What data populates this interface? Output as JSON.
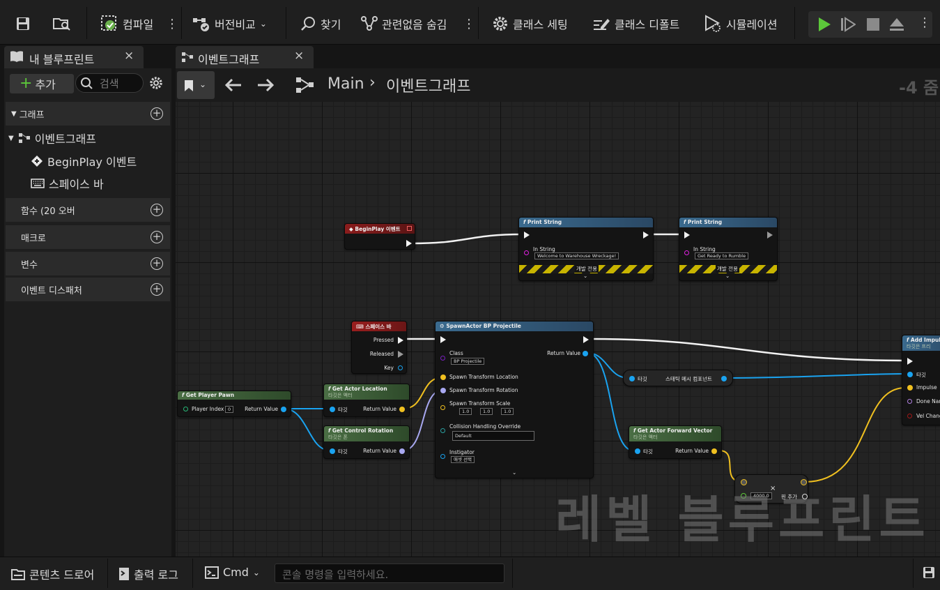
{
  "toolbar": {
    "compile": "컴파일",
    "diff": "버전비교",
    "find": "찾기",
    "hide_unrelated": "관련없음 숨김",
    "class_settings": "클래스 세팅",
    "class_defaults": "클래스 디폴트",
    "simulation": "시뮬레이션"
  },
  "left_panel": {
    "tab_title": "내 블루프린트",
    "add_label": "추가",
    "search_placeholder": "검색",
    "sections": {
      "graphs": "그래프",
      "functions": "함수 (20 오버",
      "macros": "매크로",
      "variables": "변수",
      "dispatchers": "이벤트 디스패처"
    },
    "tree": {
      "event_graph": "이벤트그래프",
      "begin_play": "BeginPlay 이벤트",
      "space_bar": "스페이스 바"
    }
  },
  "graph_tab": {
    "title": "이벤트그래프"
  },
  "breadcrumb": {
    "root": "Main",
    "current": "이벤트그래프",
    "zoom": "-4 줌"
  },
  "nodes": {
    "begin_play": {
      "title": "BeginPlay 이벤트"
    },
    "print1": {
      "title": "Print String",
      "pin": "In String",
      "value": "Welcome to Warehouse Wreckage!",
      "dev": "개발 전용"
    },
    "print2": {
      "title": "Print String",
      "pin": "In String",
      "value": "Get Ready to Rumble",
      "dev": "개발 전용"
    },
    "space": {
      "title": "스페이스 바",
      "pressed": "Pressed",
      "released": "Released",
      "key": "Key"
    },
    "spawn": {
      "title": "SpawnActor BP Projectile",
      "class": "Class",
      "class_value": "BP Projectile",
      "return": "Return Value",
      "loc": "Spawn Transform Location",
      "rot": "Spawn Transform Rotation",
      "scale": "Spawn Transform Scale",
      "sx": "1.0",
      "sy": "1.0",
      "sz": "1.0",
      "collision": "Collision Handling Override",
      "collision_value": "Default",
      "instigator": "Instigator",
      "instigator_value": "애셋 선택"
    },
    "pawn": {
      "title": "Get Player Pawn",
      "index": "Player Index",
      "index_value": "0",
      "ret": "Return Value"
    },
    "loc": {
      "title": "Get Actor Location",
      "sub": "타깃은 액터",
      "target": "타깃",
      "ret": "Return Value"
    },
    "rot": {
      "title": "Get Control Rotation",
      "sub": "타깃은 폰",
      "target": "타깃",
      "ret": "Return Value"
    },
    "mesh": {
      "target": "타깃",
      "label": "스태틱 메시 컴포넌트"
    },
    "fwd": {
      "title": "Get Actor Forward Vector",
      "sub": "타깃은 액터",
      "target": "타깃",
      "ret": "Return Value"
    },
    "mult": {
      "value": "4000.0",
      "add": "핀 추가"
    },
    "impulse": {
      "title": "Add Impul",
      "sub": "타깃은 프리",
      "target": "타깃",
      "impulse": "Impulse",
      "done": "Done Nar",
      "vel": "Vel Chang"
    }
  },
  "watermark": "레벨 블루프린트",
  "bottom": {
    "content_drawer": "콘텐츠 드로어",
    "output_log": "출력 로그",
    "cmd": "Cmd",
    "console_placeholder": "콘솔 명령을 입력하세요."
  },
  "colors": {
    "exec": "#f2f2f2",
    "object": "#1aa3f0",
    "vector": "#f0c020",
    "rotator": "#a8a8f0",
    "string": "#e020e0",
    "event_head": "#8a1c1c",
    "func_head": "#2d4a66",
    "pure_head": "#3d5a38"
  }
}
